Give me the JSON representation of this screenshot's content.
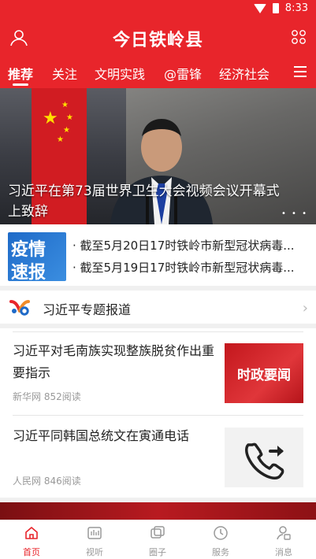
{
  "status_bar": {
    "time": "8:33"
  },
  "header": {
    "title": "今日铁岭县"
  },
  "tabs": [
    {
      "label": "推荐",
      "active": true
    },
    {
      "label": "关注"
    },
    {
      "label": "文明实践"
    },
    {
      "label": "@雷锋"
    },
    {
      "label": "经济社会"
    }
  ],
  "banner": {
    "caption": "习近平在第73届世界卫生大会视频会议开幕式上致辞",
    "pager": "• • •"
  },
  "ticker": {
    "logo_line1": "疫情",
    "logo_line2": "速报",
    "items": [
      "· 截至5月20日17时铁岭市新型冠状病毒...",
      "· 截至5月19日17时铁岭市新型冠状病毒..."
    ]
  },
  "special_report": {
    "label": "习近平专题报道"
  },
  "articles": [
    {
      "title": "习近平对毛南族实现整族脱贫作出重要指示",
      "meta": "新华网 852阅读",
      "thumb_text": "时政要闻"
    },
    {
      "title": "习近平同韩国总统文在寅通电话",
      "meta": "人民网 846阅读",
      "thumb_text": ""
    }
  ],
  "bottom_nav": [
    {
      "label": "首页",
      "icon": "home-icon",
      "active": true
    },
    {
      "label": "视听",
      "icon": "media-icon"
    },
    {
      "label": "圈子",
      "icon": "circle-icon"
    },
    {
      "label": "服务",
      "icon": "clock-icon"
    },
    {
      "label": "消息",
      "icon": "message-icon"
    }
  ],
  "colors": {
    "brand": "#e8252b",
    "accent_blue": "#1e6ac8",
    "muted": "#999999"
  }
}
